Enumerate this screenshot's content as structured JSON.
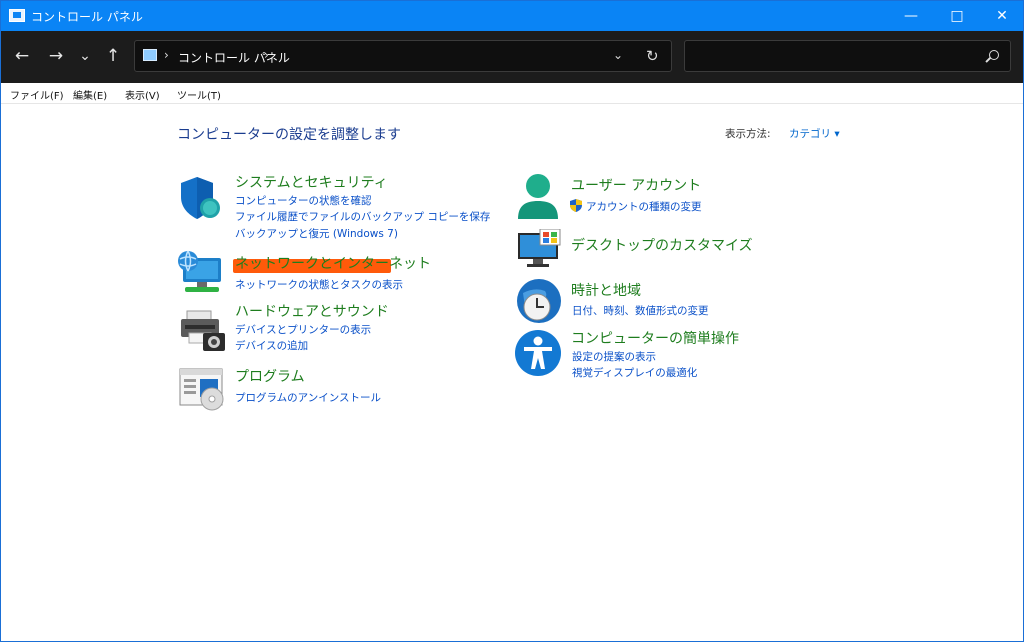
{
  "window": {
    "title": "コントロール パネル"
  },
  "window_controls": {
    "minimize": "—",
    "maximize": "□",
    "close": "✕"
  },
  "navigation": {
    "back": "←",
    "forward": "→",
    "recent": "⌄",
    "up": "↑"
  },
  "address": {
    "separator": "›",
    "crumb": "コントロール パネル",
    "dropdown": "⌄",
    "refresh": "↻"
  },
  "menu": [
    "ファイル(F)",
    "編集(E)",
    "表示(V)",
    "ツール(T)"
  ],
  "page": {
    "heading": "コンピューターの設定を調整します",
    "view_by_label": "表示方法:",
    "view_by_value": "カテゴリ ▾"
  },
  "categories": {
    "system_security": {
      "title": "システムとセキュリティ",
      "links": [
        "コンピューターの状態を確認",
        "ファイル履歴でファイルのバックアップ コピーを保存",
        "バックアップと復元 (Windows 7)"
      ]
    },
    "network": {
      "title": "ネットワークとインターネット",
      "links": [
        "ネットワークの状態とタスクの表示"
      ]
    },
    "hardware": {
      "title": "ハードウェアとサウンド",
      "links": [
        "デバイスとプリンターの表示",
        "デバイスの追加"
      ]
    },
    "programs": {
      "title": "プログラム",
      "links": [
        "プログラムのアンインストール"
      ]
    },
    "user_accounts": {
      "title": "ユーザー アカウント",
      "links": [
        "アカウントの種類の変更"
      ]
    },
    "appearance": {
      "title": "デスクトップのカスタマイズ",
      "links": []
    },
    "clock_region": {
      "title": "時計と地域",
      "links": [
        "日付、時刻、数値形式の変更"
      ]
    },
    "ease_of_access": {
      "title": "コンピューターの簡単操作",
      "links": [
        "設定の提案の表示",
        "視覚ディスプレイの最適化"
      ]
    }
  },
  "colors": {
    "titlebar": "#0a84f5",
    "toolbar": "#1c1c1c",
    "category_title": "#1e7d1e",
    "link": "#0a50c8",
    "highlight": "#ff5a0a"
  }
}
